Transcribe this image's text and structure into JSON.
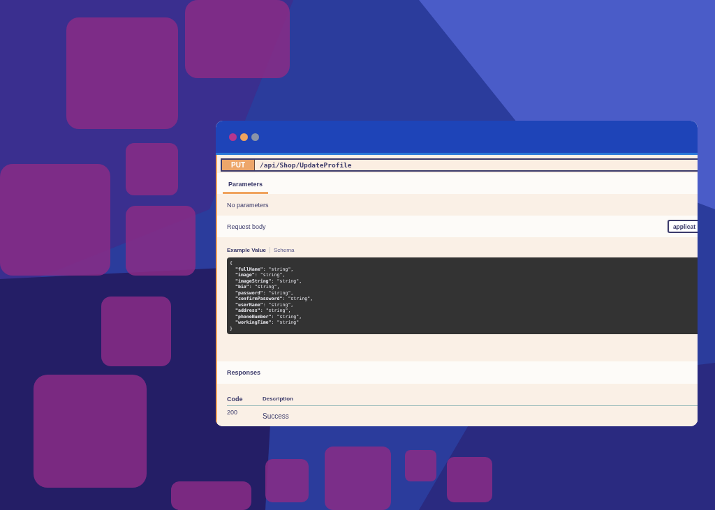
{
  "window": {
    "controls": [
      {
        "color": "#b5368f"
      },
      {
        "color": "#f0a35e"
      },
      {
        "color": "#8a93a8"
      }
    ]
  },
  "operation": {
    "method": "PUT",
    "path": "/api/Shop/UpdateProfile"
  },
  "tabs": [
    {
      "label": "Parameters",
      "selected": true
    }
  ],
  "parameters_message": "No parameters",
  "request_body": {
    "label": "Request body",
    "content_type": "applicat"
  },
  "example_tabs": [
    {
      "label": "Example Value",
      "selected": true
    },
    {
      "label": "Schema",
      "selected": false
    }
  ],
  "example_lines": [
    "{",
    "  **\"fullName\"**: \"string\",",
    "  **\"image\"**: \"string\",",
    "  **\"imageString\"**: \"string\",",
    "  **\"bio\"**: \"string\",",
    "  **\"password\"**: \"string\",",
    "  **\"confirmPassword\"**: \"string\",",
    "  **\"userName\"**: \"string\",",
    "  **\"address\"**: \"string\",",
    "  **\"phoneNumber\"**: \"string\",",
    "  **\"workingTime\"**: \"string\"",
    "}"
  ],
  "responses": {
    "title": "Responses",
    "columns": [
      "Code",
      "Description"
    ],
    "rows": [
      {
        "code": "200",
        "description": "Success"
      }
    ]
  }
}
